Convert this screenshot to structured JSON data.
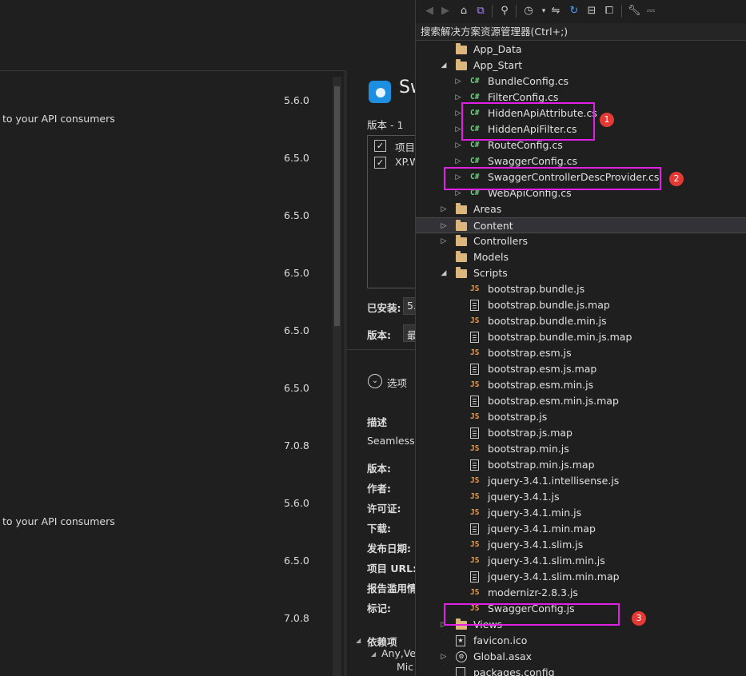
{
  "packages": [
    {
      "description": "",
      "version": "5.6.0"
    },
    {
      "description": "to your API consumers",
      "version": ""
    },
    {
      "description": "",
      "version": "6.5.0"
    },
    {
      "description": "",
      "version": "6.5.0"
    },
    {
      "description": "",
      "version": "6.5.0"
    },
    {
      "description": "",
      "version": "6.5.0"
    },
    {
      "description": "",
      "version": "6.5.0"
    },
    {
      "description": "",
      "version": "7.0.8"
    },
    {
      "description": "",
      "version": "5.6.0"
    },
    {
      "description": "to your API consumers",
      "version": ""
    },
    {
      "description": "",
      "version": "6.5.0"
    },
    {
      "description": "",
      "version": "7.0.8"
    }
  ],
  "detail": {
    "title": "Sw",
    "version_count": "版本 - 1",
    "projects_col": "项目",
    "project_item": "XP.W",
    "installed_label": "已安装:",
    "installed_value": "5.",
    "version_label": "版本:",
    "version_value": "最",
    "options_label": "选项",
    "desc_label": "描述",
    "desc_text": "Seamlessl",
    "meta_version": "版本:",
    "meta_author": "作者:",
    "meta_license": "许可证:",
    "meta_download": "下载:",
    "meta_published": "发布日期:",
    "meta_url": "项目 URL:",
    "meta_report": "报告滥用情",
    "meta_tags": "标记:",
    "deps_label": "依赖项",
    "dep1": "Any,Ve",
    "dep2": "Mic"
  },
  "solution_explorer": {
    "search_placeholder": "搜索解决方案资源管理器(Ctrl+;)",
    "toolbar": [
      "back-icon",
      "forward-icon",
      "home-icon",
      "vs-switch-icon",
      "pending-changes-icon",
      "history-icon",
      "dropdown-icon",
      "sync-icon",
      "refresh-icon",
      "collapse-all-icon",
      "show-all-files-icon",
      "properties-icon",
      "preview-icon"
    ],
    "tree": [
      {
        "label": "App_Data",
        "icon": "folder",
        "indent": 1,
        "expander": ""
      },
      {
        "label": "App_Start",
        "icon": "folder",
        "indent": 1,
        "expander": "expanded"
      },
      {
        "label": "BundleConfig.cs",
        "icon": "cs",
        "indent": 2,
        "expander": "collapsed"
      },
      {
        "label": "FilterConfig.cs",
        "icon": "cs",
        "indent": 2,
        "expander": "collapsed"
      },
      {
        "label": "HiddenApiAttribute.cs",
        "icon": "cs",
        "indent": 2,
        "expander": "collapsed"
      },
      {
        "label": "HiddenApiFilter.cs",
        "icon": "cs",
        "indent": 2,
        "expander": "collapsed"
      },
      {
        "label": "RouteConfig.cs",
        "icon": "cs",
        "indent": 2,
        "expander": "collapsed"
      },
      {
        "label": "SwaggerConfig.cs",
        "icon": "cs",
        "indent": 2,
        "expander": "collapsed"
      },
      {
        "label": "SwaggerControllerDescProvider.cs",
        "icon": "cs",
        "indent": 2,
        "expander": "collapsed"
      },
      {
        "label": "WebApiConfig.cs",
        "icon": "cs",
        "indent": 2,
        "expander": "collapsed"
      },
      {
        "label": "Areas",
        "icon": "folder",
        "indent": 1,
        "expander": "collapsed"
      },
      {
        "label": "Content",
        "icon": "folder",
        "indent": 1,
        "expander": "collapsed",
        "selected": true
      },
      {
        "label": "Controllers",
        "icon": "folder",
        "indent": 1,
        "expander": "collapsed"
      },
      {
        "label": "Models",
        "icon": "folder",
        "indent": 1,
        "expander": ""
      },
      {
        "label": "Scripts",
        "icon": "folder",
        "indent": 1,
        "expander": "expanded"
      },
      {
        "label": "bootstrap.bundle.js",
        "icon": "js",
        "indent": 2,
        "expander": ""
      },
      {
        "label": "bootstrap.bundle.js.map",
        "icon": "map",
        "indent": 2,
        "expander": ""
      },
      {
        "label": "bootstrap.bundle.min.js",
        "icon": "js",
        "indent": 2,
        "expander": ""
      },
      {
        "label": "bootstrap.bundle.min.js.map",
        "icon": "map",
        "indent": 2,
        "expander": ""
      },
      {
        "label": "bootstrap.esm.js",
        "icon": "js",
        "indent": 2,
        "expander": ""
      },
      {
        "label": "bootstrap.esm.js.map",
        "icon": "map",
        "indent": 2,
        "expander": ""
      },
      {
        "label": "bootstrap.esm.min.js",
        "icon": "js",
        "indent": 2,
        "expander": ""
      },
      {
        "label": "bootstrap.esm.min.js.map",
        "icon": "map",
        "indent": 2,
        "expander": ""
      },
      {
        "label": "bootstrap.js",
        "icon": "js",
        "indent": 2,
        "expander": ""
      },
      {
        "label": "bootstrap.js.map",
        "icon": "map",
        "indent": 2,
        "expander": ""
      },
      {
        "label": "bootstrap.min.js",
        "icon": "js",
        "indent": 2,
        "expander": ""
      },
      {
        "label": "bootstrap.min.js.map",
        "icon": "map",
        "indent": 2,
        "expander": ""
      },
      {
        "label": "jquery-3.4.1.intellisense.js",
        "icon": "js",
        "indent": 2,
        "expander": ""
      },
      {
        "label": "jquery-3.4.1.js",
        "icon": "js",
        "indent": 2,
        "expander": ""
      },
      {
        "label": "jquery-3.4.1.min.js",
        "icon": "js",
        "indent": 2,
        "expander": ""
      },
      {
        "label": "jquery-3.4.1.min.map",
        "icon": "map",
        "indent": 2,
        "expander": ""
      },
      {
        "label": "jquery-3.4.1.slim.js",
        "icon": "js",
        "indent": 2,
        "expander": ""
      },
      {
        "label": "jquery-3.4.1.slim.min.js",
        "icon": "js",
        "indent": 2,
        "expander": ""
      },
      {
        "label": "jquery-3.4.1.slim.min.map",
        "icon": "map",
        "indent": 2,
        "expander": ""
      },
      {
        "label": "modernizr-2.8.3.js",
        "icon": "js",
        "indent": 2,
        "expander": ""
      },
      {
        "label": "SwaggerConfig.js",
        "icon": "js",
        "indent": 2,
        "expander": ""
      },
      {
        "label": "Views",
        "icon": "folder",
        "indent": 1,
        "expander": "collapsed"
      },
      {
        "label": "favicon.ico",
        "icon": "ico",
        "indent": 1,
        "expander": ""
      },
      {
        "label": "Global.asax",
        "icon": "asax",
        "indent": 1,
        "expander": "collapsed"
      },
      {
        "label": "packages.config",
        "icon": "config",
        "indent": 1,
        "expander": ""
      }
    ]
  },
  "annotations": [
    "1",
    "2",
    "3"
  ],
  "colors": {
    "highlight": "#e11fe6",
    "badge": "#e53935",
    "folder": "#dcb67a",
    "cs": "#6fcf7f",
    "js": "#e89b4a"
  }
}
